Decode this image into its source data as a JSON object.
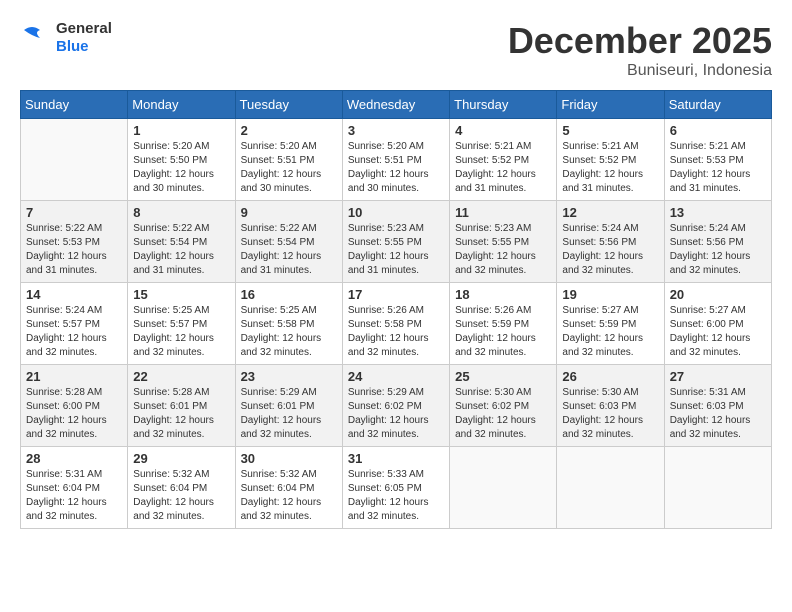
{
  "logo": {
    "text_general": "General",
    "text_blue": "Blue"
  },
  "header": {
    "month": "December 2025",
    "location": "Buniseuri, Indonesia"
  },
  "weekdays": [
    "Sunday",
    "Monday",
    "Tuesday",
    "Wednesday",
    "Thursday",
    "Friday",
    "Saturday"
  ],
  "rows": [
    [
      {
        "day": "",
        "empty": true
      },
      {
        "day": "1",
        "sunrise": "Sunrise: 5:20 AM",
        "sunset": "Sunset: 5:50 PM",
        "daylight": "Daylight: 12 hours and 30 minutes."
      },
      {
        "day": "2",
        "sunrise": "Sunrise: 5:20 AM",
        "sunset": "Sunset: 5:51 PM",
        "daylight": "Daylight: 12 hours and 30 minutes."
      },
      {
        "day": "3",
        "sunrise": "Sunrise: 5:20 AM",
        "sunset": "Sunset: 5:51 PM",
        "daylight": "Daylight: 12 hours and 30 minutes."
      },
      {
        "day": "4",
        "sunrise": "Sunrise: 5:21 AM",
        "sunset": "Sunset: 5:52 PM",
        "daylight": "Daylight: 12 hours and 31 minutes."
      },
      {
        "day": "5",
        "sunrise": "Sunrise: 5:21 AM",
        "sunset": "Sunset: 5:52 PM",
        "daylight": "Daylight: 12 hours and 31 minutes."
      },
      {
        "day": "6",
        "sunrise": "Sunrise: 5:21 AM",
        "sunset": "Sunset: 5:53 PM",
        "daylight": "Daylight: 12 hours and 31 minutes."
      }
    ],
    [
      {
        "day": "7",
        "sunrise": "Sunrise: 5:22 AM",
        "sunset": "Sunset: 5:53 PM",
        "daylight": "Daylight: 12 hours and 31 minutes."
      },
      {
        "day": "8",
        "sunrise": "Sunrise: 5:22 AM",
        "sunset": "Sunset: 5:54 PM",
        "daylight": "Daylight: 12 hours and 31 minutes."
      },
      {
        "day": "9",
        "sunrise": "Sunrise: 5:22 AM",
        "sunset": "Sunset: 5:54 PM",
        "daylight": "Daylight: 12 hours and 31 minutes."
      },
      {
        "day": "10",
        "sunrise": "Sunrise: 5:23 AM",
        "sunset": "Sunset: 5:55 PM",
        "daylight": "Daylight: 12 hours and 31 minutes."
      },
      {
        "day": "11",
        "sunrise": "Sunrise: 5:23 AM",
        "sunset": "Sunset: 5:55 PM",
        "daylight": "Daylight: 12 hours and 32 minutes."
      },
      {
        "day": "12",
        "sunrise": "Sunrise: 5:24 AM",
        "sunset": "Sunset: 5:56 PM",
        "daylight": "Daylight: 12 hours and 32 minutes."
      },
      {
        "day": "13",
        "sunrise": "Sunrise: 5:24 AM",
        "sunset": "Sunset: 5:56 PM",
        "daylight": "Daylight: 12 hours and 32 minutes."
      }
    ],
    [
      {
        "day": "14",
        "sunrise": "Sunrise: 5:24 AM",
        "sunset": "Sunset: 5:57 PM",
        "daylight": "Daylight: 12 hours and 32 minutes."
      },
      {
        "day": "15",
        "sunrise": "Sunrise: 5:25 AM",
        "sunset": "Sunset: 5:57 PM",
        "daylight": "Daylight: 12 hours and 32 minutes."
      },
      {
        "day": "16",
        "sunrise": "Sunrise: 5:25 AM",
        "sunset": "Sunset: 5:58 PM",
        "daylight": "Daylight: 12 hours and 32 minutes."
      },
      {
        "day": "17",
        "sunrise": "Sunrise: 5:26 AM",
        "sunset": "Sunset: 5:58 PM",
        "daylight": "Daylight: 12 hours and 32 minutes."
      },
      {
        "day": "18",
        "sunrise": "Sunrise: 5:26 AM",
        "sunset": "Sunset: 5:59 PM",
        "daylight": "Daylight: 12 hours and 32 minutes."
      },
      {
        "day": "19",
        "sunrise": "Sunrise: 5:27 AM",
        "sunset": "Sunset: 5:59 PM",
        "daylight": "Daylight: 12 hours and 32 minutes."
      },
      {
        "day": "20",
        "sunrise": "Sunrise: 5:27 AM",
        "sunset": "Sunset: 6:00 PM",
        "daylight": "Daylight: 12 hours and 32 minutes."
      }
    ],
    [
      {
        "day": "21",
        "sunrise": "Sunrise: 5:28 AM",
        "sunset": "Sunset: 6:00 PM",
        "daylight": "Daylight: 12 hours and 32 minutes."
      },
      {
        "day": "22",
        "sunrise": "Sunrise: 5:28 AM",
        "sunset": "Sunset: 6:01 PM",
        "daylight": "Daylight: 12 hours and 32 minutes."
      },
      {
        "day": "23",
        "sunrise": "Sunrise: 5:29 AM",
        "sunset": "Sunset: 6:01 PM",
        "daylight": "Daylight: 12 hours and 32 minutes."
      },
      {
        "day": "24",
        "sunrise": "Sunrise: 5:29 AM",
        "sunset": "Sunset: 6:02 PM",
        "daylight": "Daylight: 12 hours and 32 minutes."
      },
      {
        "day": "25",
        "sunrise": "Sunrise: 5:30 AM",
        "sunset": "Sunset: 6:02 PM",
        "daylight": "Daylight: 12 hours and 32 minutes."
      },
      {
        "day": "26",
        "sunrise": "Sunrise: 5:30 AM",
        "sunset": "Sunset: 6:03 PM",
        "daylight": "Daylight: 12 hours and 32 minutes."
      },
      {
        "day": "27",
        "sunrise": "Sunrise: 5:31 AM",
        "sunset": "Sunset: 6:03 PM",
        "daylight": "Daylight: 12 hours and 32 minutes."
      }
    ],
    [
      {
        "day": "28",
        "sunrise": "Sunrise: 5:31 AM",
        "sunset": "Sunset: 6:04 PM",
        "daylight": "Daylight: 12 hours and 32 minutes."
      },
      {
        "day": "29",
        "sunrise": "Sunrise: 5:32 AM",
        "sunset": "Sunset: 6:04 PM",
        "daylight": "Daylight: 12 hours and 32 minutes."
      },
      {
        "day": "30",
        "sunrise": "Sunrise: 5:32 AM",
        "sunset": "Sunset: 6:04 PM",
        "daylight": "Daylight: 12 hours and 32 minutes."
      },
      {
        "day": "31",
        "sunrise": "Sunrise: 5:33 AM",
        "sunset": "Sunset: 6:05 PM",
        "daylight": "Daylight: 12 hours and 32 minutes."
      },
      {
        "day": "",
        "empty": true
      },
      {
        "day": "",
        "empty": true
      },
      {
        "day": "",
        "empty": true
      }
    ]
  ]
}
